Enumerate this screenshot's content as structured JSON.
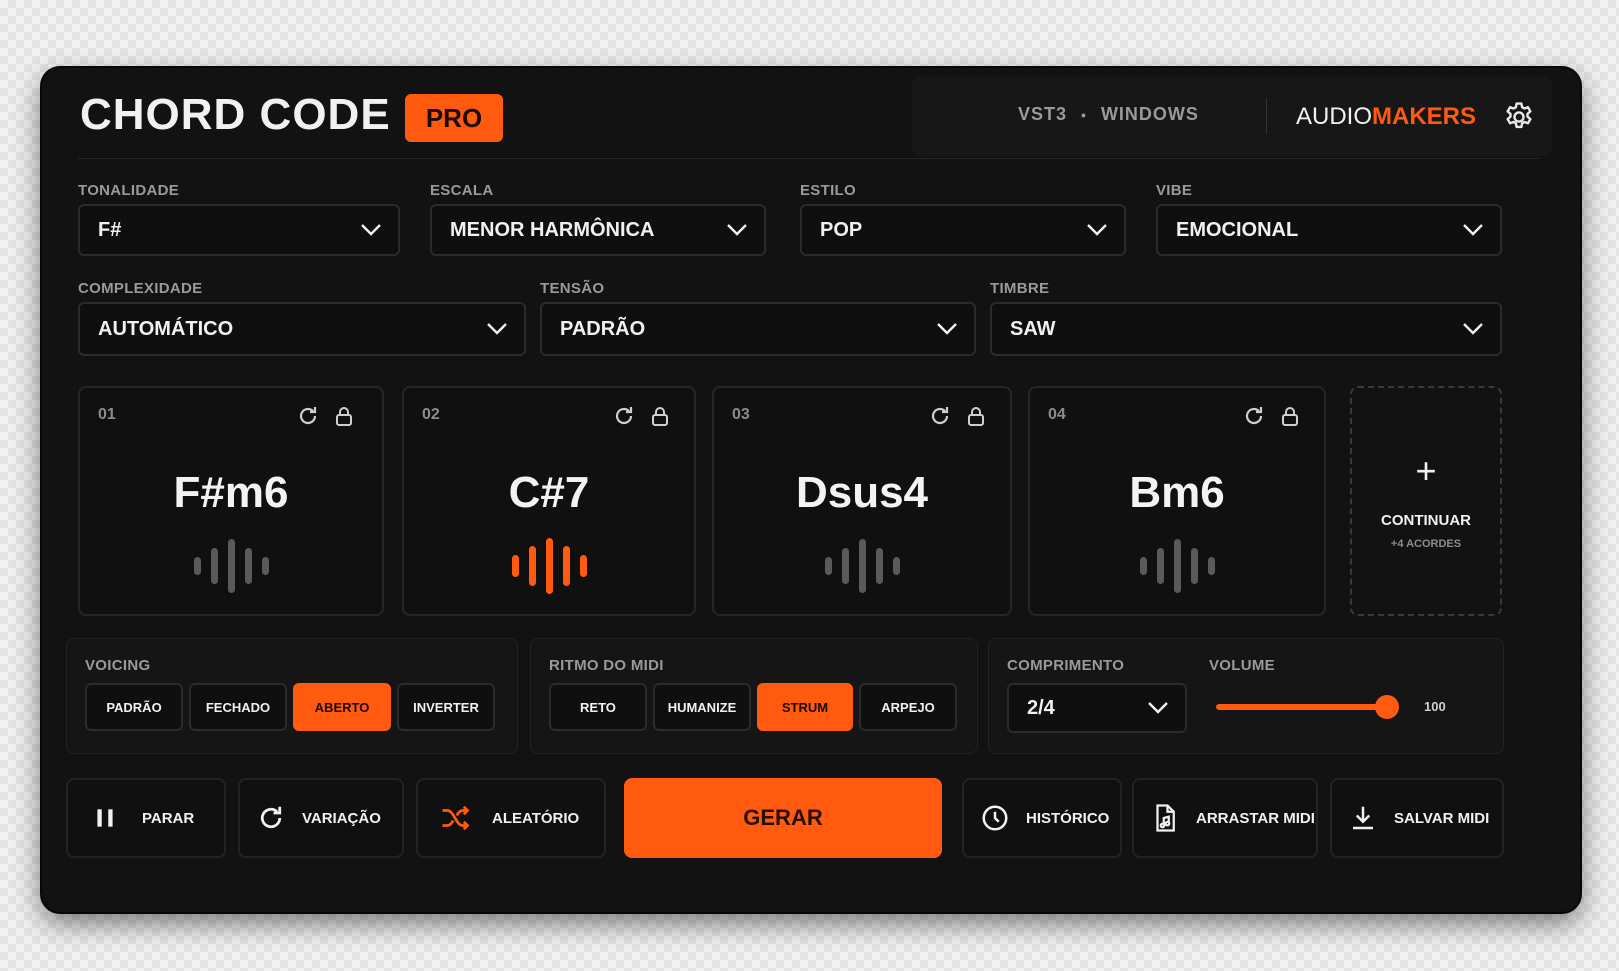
{
  "header": {
    "title": "CHORD CODE",
    "badge": "PRO",
    "format": "VST3",
    "separator": "•",
    "platform": "WINDOWS",
    "brand_part1": "AUDIO",
    "brand_part2": "MAKERS",
    "settings_icon": "gear-icon"
  },
  "selectors_row1": [
    {
      "label": "TONALIDADE",
      "value": "F#"
    },
    {
      "label": "ESCALA",
      "value": "MENOR HARMÔNICA"
    },
    {
      "label": "ESTILO",
      "value": "POP"
    },
    {
      "label": "VIBE",
      "value": "EMOCIONAL"
    }
  ],
  "selectors_row2": [
    {
      "label": "COMPLEXIDADE",
      "value": "AUTOMÁTICO"
    },
    {
      "label": "TENSÃO",
      "value": "PADRÃO"
    },
    {
      "label": "TIMBRE",
      "value": "SAW"
    }
  ],
  "chords": [
    {
      "index": "01",
      "name": "F#m6",
      "playing": false
    },
    {
      "index": "02",
      "name": "C#7",
      "playing": true
    },
    {
      "index": "03",
      "name": "Dsus4",
      "playing": false
    },
    {
      "index": "04",
      "name": "Bm6",
      "playing": false
    }
  ],
  "continue": {
    "plus": "+",
    "label": "CONTINUAR",
    "sub": "+4 ACORDES"
  },
  "voicing": {
    "label": "VOICING",
    "options": [
      "PADRÃO",
      "FECHADO",
      "ABERTO",
      "INVERTER"
    ],
    "selected": "ABERTO"
  },
  "rhythm": {
    "label": "RITMO DO MIDI",
    "options": [
      "RETO",
      "HUMANIZE",
      "STRUM",
      "ARPEJO"
    ],
    "selected": "STRUM"
  },
  "length": {
    "label": "COMPRIMENTO",
    "value": "2/4"
  },
  "volume": {
    "label": "VOLUME",
    "value": "100"
  },
  "actions": {
    "stop": "PARAR",
    "variation": "VARIAÇÃO",
    "random": "ALEATÓRIO",
    "generate": "GERAR",
    "history": "HISTÓRICO",
    "drag_midi": "ARRASTAR MIDI",
    "save_midi": "SALVAR MIDI"
  },
  "colors": {
    "accent": "#ff5a10",
    "panel": "#121212",
    "text": "#f1f1f1",
    "muted": "#9a9a9a"
  }
}
